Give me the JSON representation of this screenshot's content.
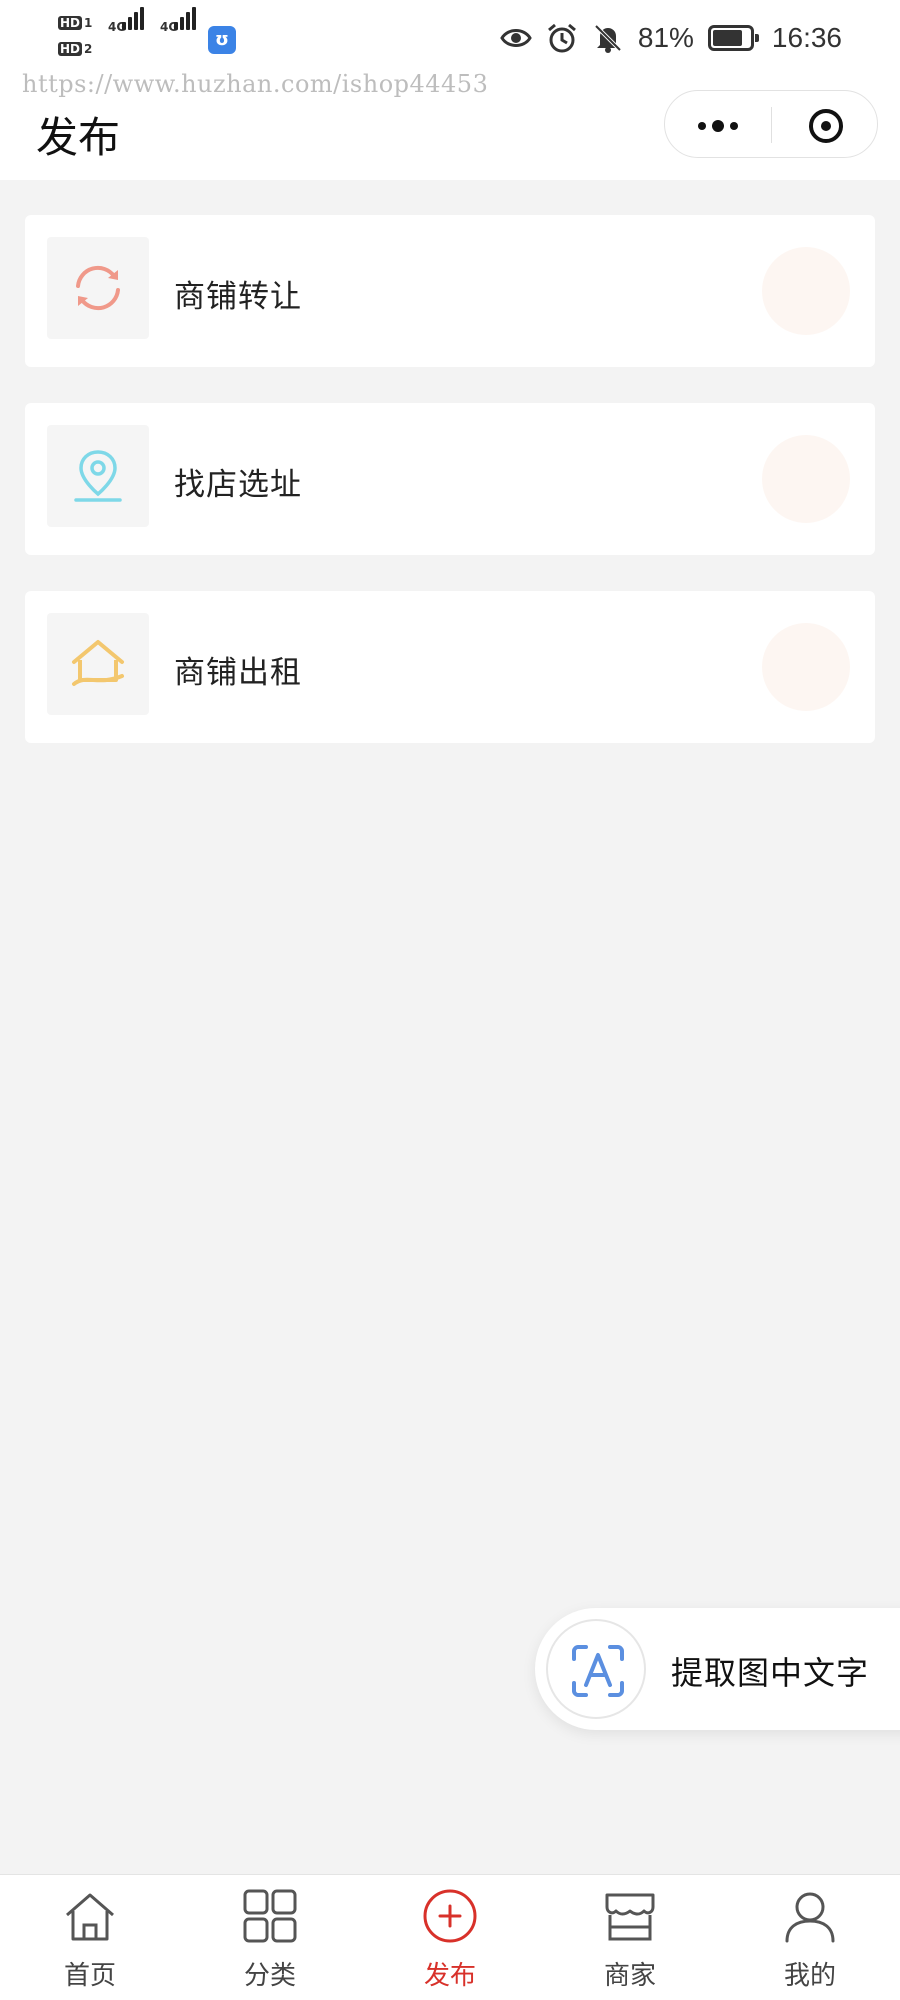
{
  "status_bar": {
    "sim1_badge": "HD",
    "sim1_num": "1",
    "sim2_badge": "HD",
    "sim2_num": "2",
    "network1": "4G",
    "network2": "4G",
    "battery_percent": "81%",
    "battery_level": 0.81,
    "time": "16:36",
    "icons": [
      "eye-icon",
      "alarm-icon",
      "mute-icon",
      "battery-icon"
    ]
  },
  "watermark": "https://www.huzhan.com/ishop44453",
  "header": {
    "title": "发布",
    "more_button": "more-icon",
    "close_button": "target-icon"
  },
  "cards": [
    {
      "label": "商铺转让",
      "icon": "refresh-icon",
      "icon_color": "#f0998a"
    },
    {
      "label": "找店选址",
      "icon": "location-pin-icon",
      "icon_color": "#7ed8e8"
    },
    {
      "label": "商铺出租",
      "icon": "house-icon",
      "icon_color": "#f3c76e"
    }
  ],
  "float_button": {
    "label": "提取图中文字",
    "icon": "text-scan-icon",
    "icon_color": "#5b8fe0"
  },
  "tab_bar": {
    "tabs": [
      {
        "label": "首页",
        "icon": "home-icon",
        "active": false
      },
      {
        "label": "分类",
        "icon": "grid-icon",
        "active": false
      },
      {
        "label": "发布",
        "icon": "plus-circle-icon",
        "active": true
      },
      {
        "label": "商家",
        "icon": "store-icon",
        "active": false
      },
      {
        "label": "我的",
        "icon": "user-icon",
        "active": false
      }
    ],
    "active_color": "#d8312a",
    "inactive_color": "#444444"
  }
}
